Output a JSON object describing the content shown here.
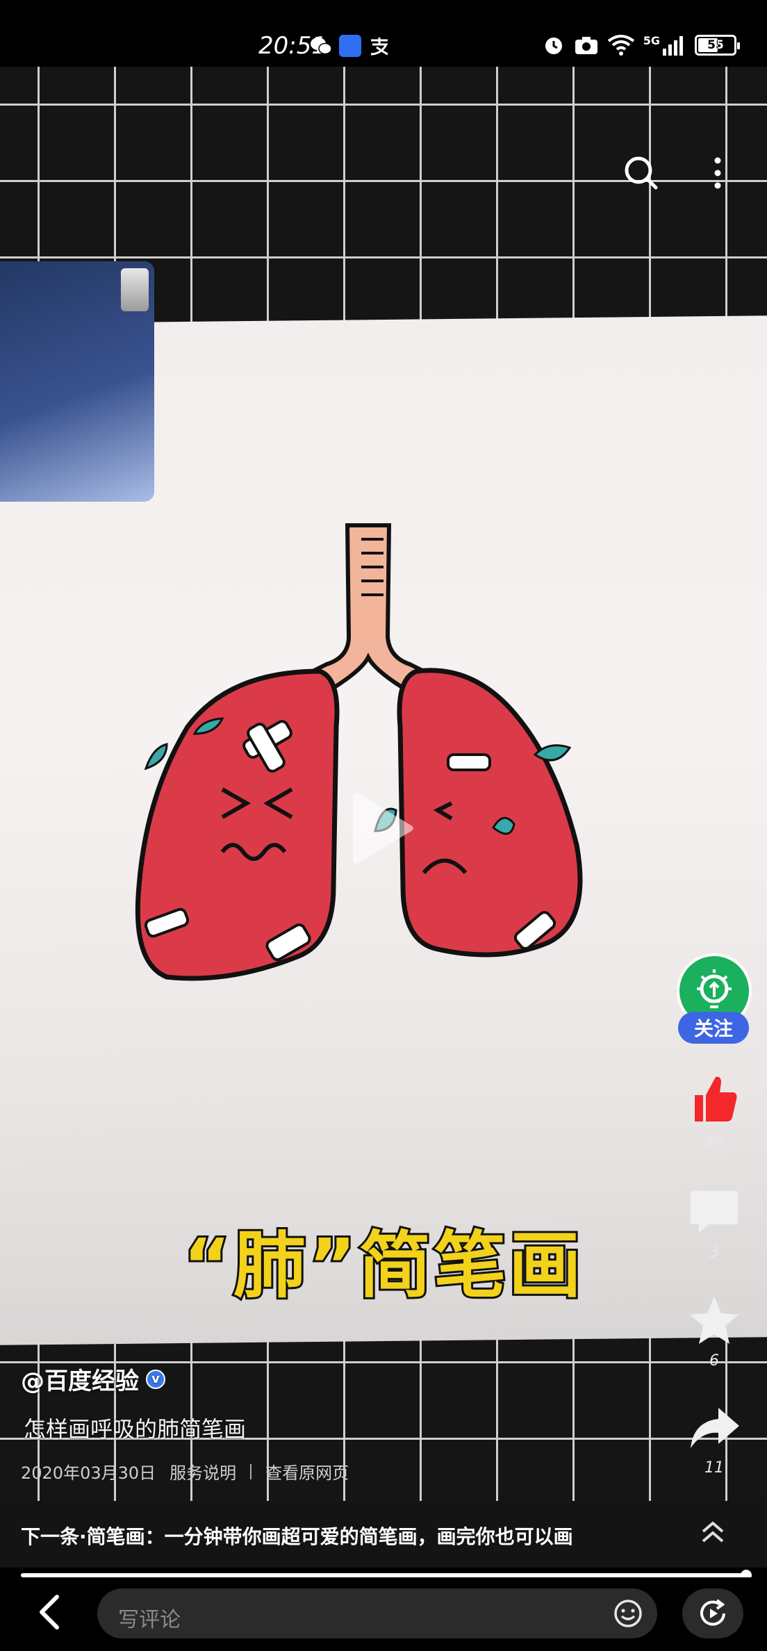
{
  "status_bar": {
    "time": "20:51",
    "network": "5G",
    "battery": "55",
    "icons": [
      "wechat-icon",
      "baidu-icon",
      "alipay-icon",
      "alarm-icon",
      "camera-icon",
      "wifi-icon",
      "signal-icon",
      "battery-icon"
    ]
  },
  "video": {
    "overlay_title": "“肺”简笔画",
    "top_icons": [
      "search-icon",
      "more-icon"
    ]
  },
  "rail": {
    "follow_label": "关注",
    "likes": "56",
    "comments": "3",
    "favorites": "6",
    "shares": "11",
    "accent": "#3e66e3",
    "like_color": "#f2282a"
  },
  "meta": {
    "author": "@百度经验",
    "description": "怎样画呼吸的肺简笔画",
    "date": "2020年03月30日",
    "service": "服务说明",
    "view_original": "查看原网页"
  },
  "next": {
    "text": "下一条·简笔画：一分钟带你画超可爱的简笔画，画完你也可以画",
    "progress": 1.0
  },
  "bottom": {
    "comment_placeholder": "写评论"
  }
}
